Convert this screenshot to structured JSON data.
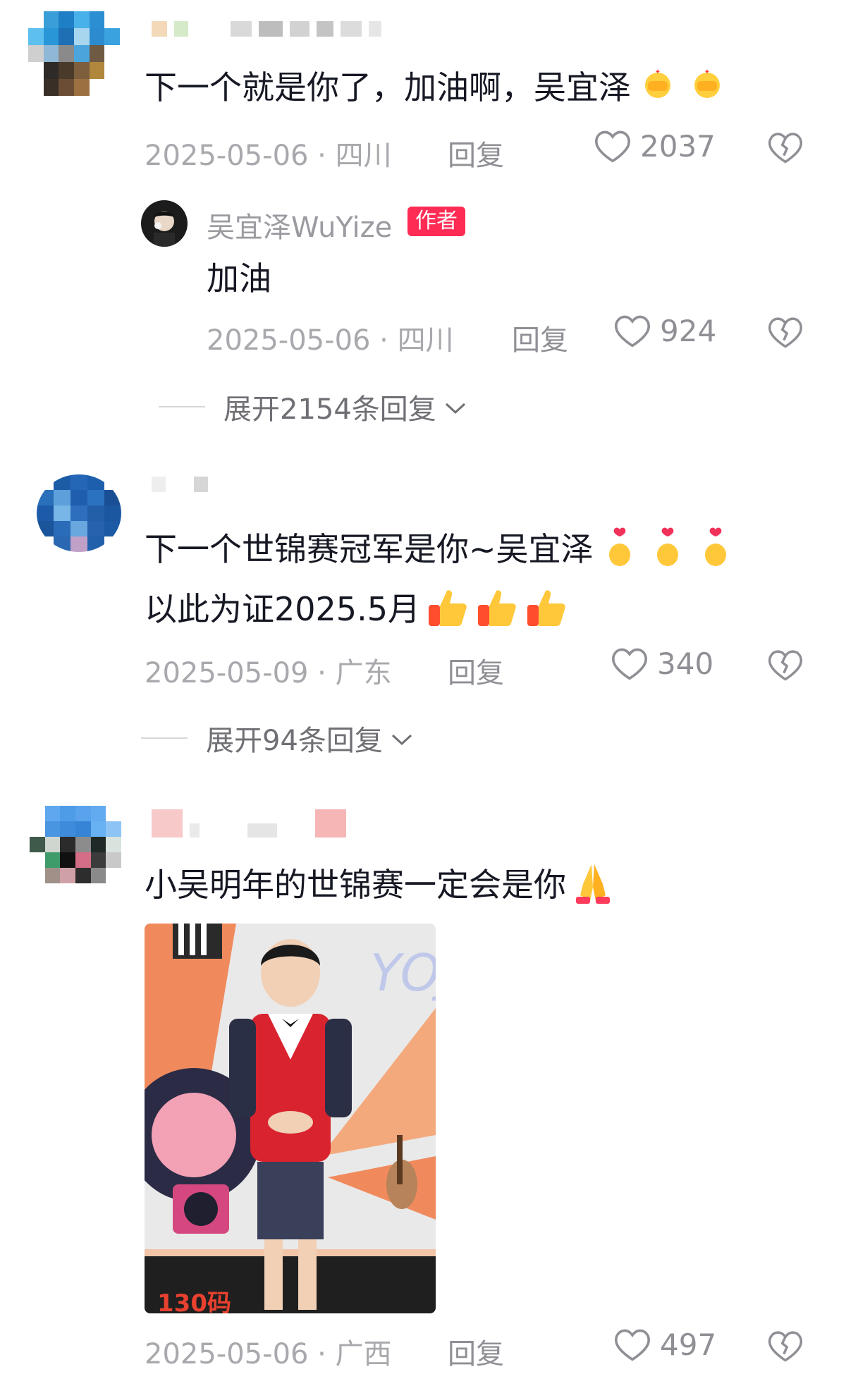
{
  "comments": [
    {
      "text": "下一个就是你了，加油啊，吴宜泽",
      "date": "2025-05-06 · 四川",
      "reply_label": "回复",
      "likes": "2037",
      "emoji": "fist-icon",
      "sub_reply": {
        "author": "吴宜泽WuYize",
        "badge": "作者",
        "text": "加油",
        "date": "2025-05-06 · 四川",
        "reply_label": "回复",
        "likes": "924"
      },
      "expand_label": "展开2154条回复"
    },
    {
      "text_line1": "下一个世锦赛冠军是你~吴宜泽",
      "text_line2": "以此为证2025.5月",
      "date": "2025-05-09 · 广东",
      "reply_label": "回复",
      "likes": "340",
      "expand_label": "展开94条回复"
    },
    {
      "text": "小吴明年的世锦赛一定会是你",
      "photo_caption": "130码",
      "photo_sign": "YOJO",
      "date": "2025-05-06 · 广西",
      "reply_label": "回复",
      "likes": "497"
    }
  ],
  "colors": {
    "accent": "#fe2c55",
    "meta": "#a8a8ad",
    "text": "#161823"
  }
}
